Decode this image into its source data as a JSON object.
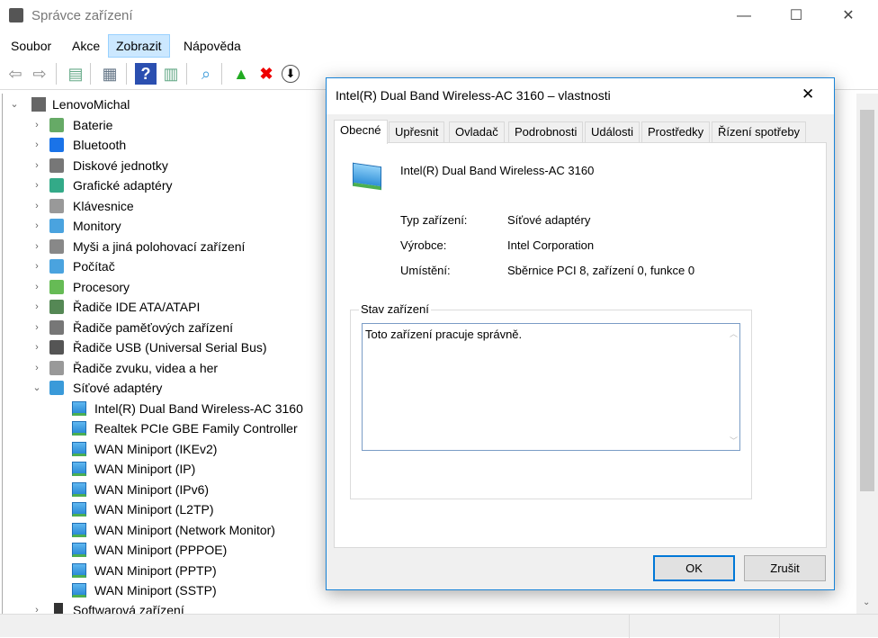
{
  "window": {
    "title": "Správce zařízení",
    "minimize": "—",
    "maximize": "☐",
    "close": "✕"
  },
  "menu": [
    "Soubor",
    "Akce",
    "Zobrazit",
    "Nápověda"
  ],
  "toolbar": [
    "back-icon",
    "forward-icon",
    "show-hide-console-tree-icon",
    "properties-icon",
    "help-icon",
    "show-action-pane-icon",
    "scan-hardware-icon",
    "update-driver-icon",
    "uninstall-icon",
    "disable-device-icon"
  ],
  "tree": {
    "root": "LenovoMichal",
    "categories": [
      "Baterie",
      "Bluetooth",
      "Diskové jednotky",
      "Grafické adaptéry",
      "Klávesnice",
      "Monitory",
      "Myši a jiná polohovací zařízení",
      "Počítač",
      "Procesory",
      "Řadiče IDE ATA/ATAPI",
      "Řadiče paměťových zařízení",
      "Řadiče USB (Universal Serial Bus)",
      "Řadiče zvuku, videa a her",
      "Síťové adaptéry"
    ],
    "network_adapters": [
      "Intel(R) Dual Band Wireless-AC 3160",
      "Realtek PCIe GBE Family Controller",
      "WAN Miniport (IKEv2)",
      "WAN Miniport (IP)",
      "WAN Miniport (IPv6)",
      "WAN Miniport (L2TP)",
      "WAN Miniport (Network Monitor)",
      "WAN Miniport (PPPOE)",
      "WAN Miniport (PPTP)",
      "WAN Miniport (SSTP)"
    ],
    "after": "Softwarová zařízení"
  },
  "dialog": {
    "title": "Intel(R) Dual Band Wireless-AC 3160 – vlastnosti",
    "close": "✕",
    "tabs": [
      "Obecné",
      "Upřesnit",
      "Ovladač",
      "Podrobnosti",
      "Události",
      "Prostředky",
      "Řízení spotřeby"
    ],
    "device_name": "Intel(R) Dual Band Wireless-AC 3160",
    "fields": [
      {
        "label": "Typ zařízení:",
        "value": "Síťové adaptéry"
      },
      {
        "label": "Výrobce:",
        "value": "Intel Corporation"
      },
      {
        "label": "Umístění:",
        "value": "Sběrnice PCI 8, zařízení 0, funkce 0"
      }
    ],
    "status_group": "Stav zařízení",
    "status_text": "Toto zařízení pracuje správně.",
    "ok": "OK",
    "cancel": "Zrušit"
  }
}
